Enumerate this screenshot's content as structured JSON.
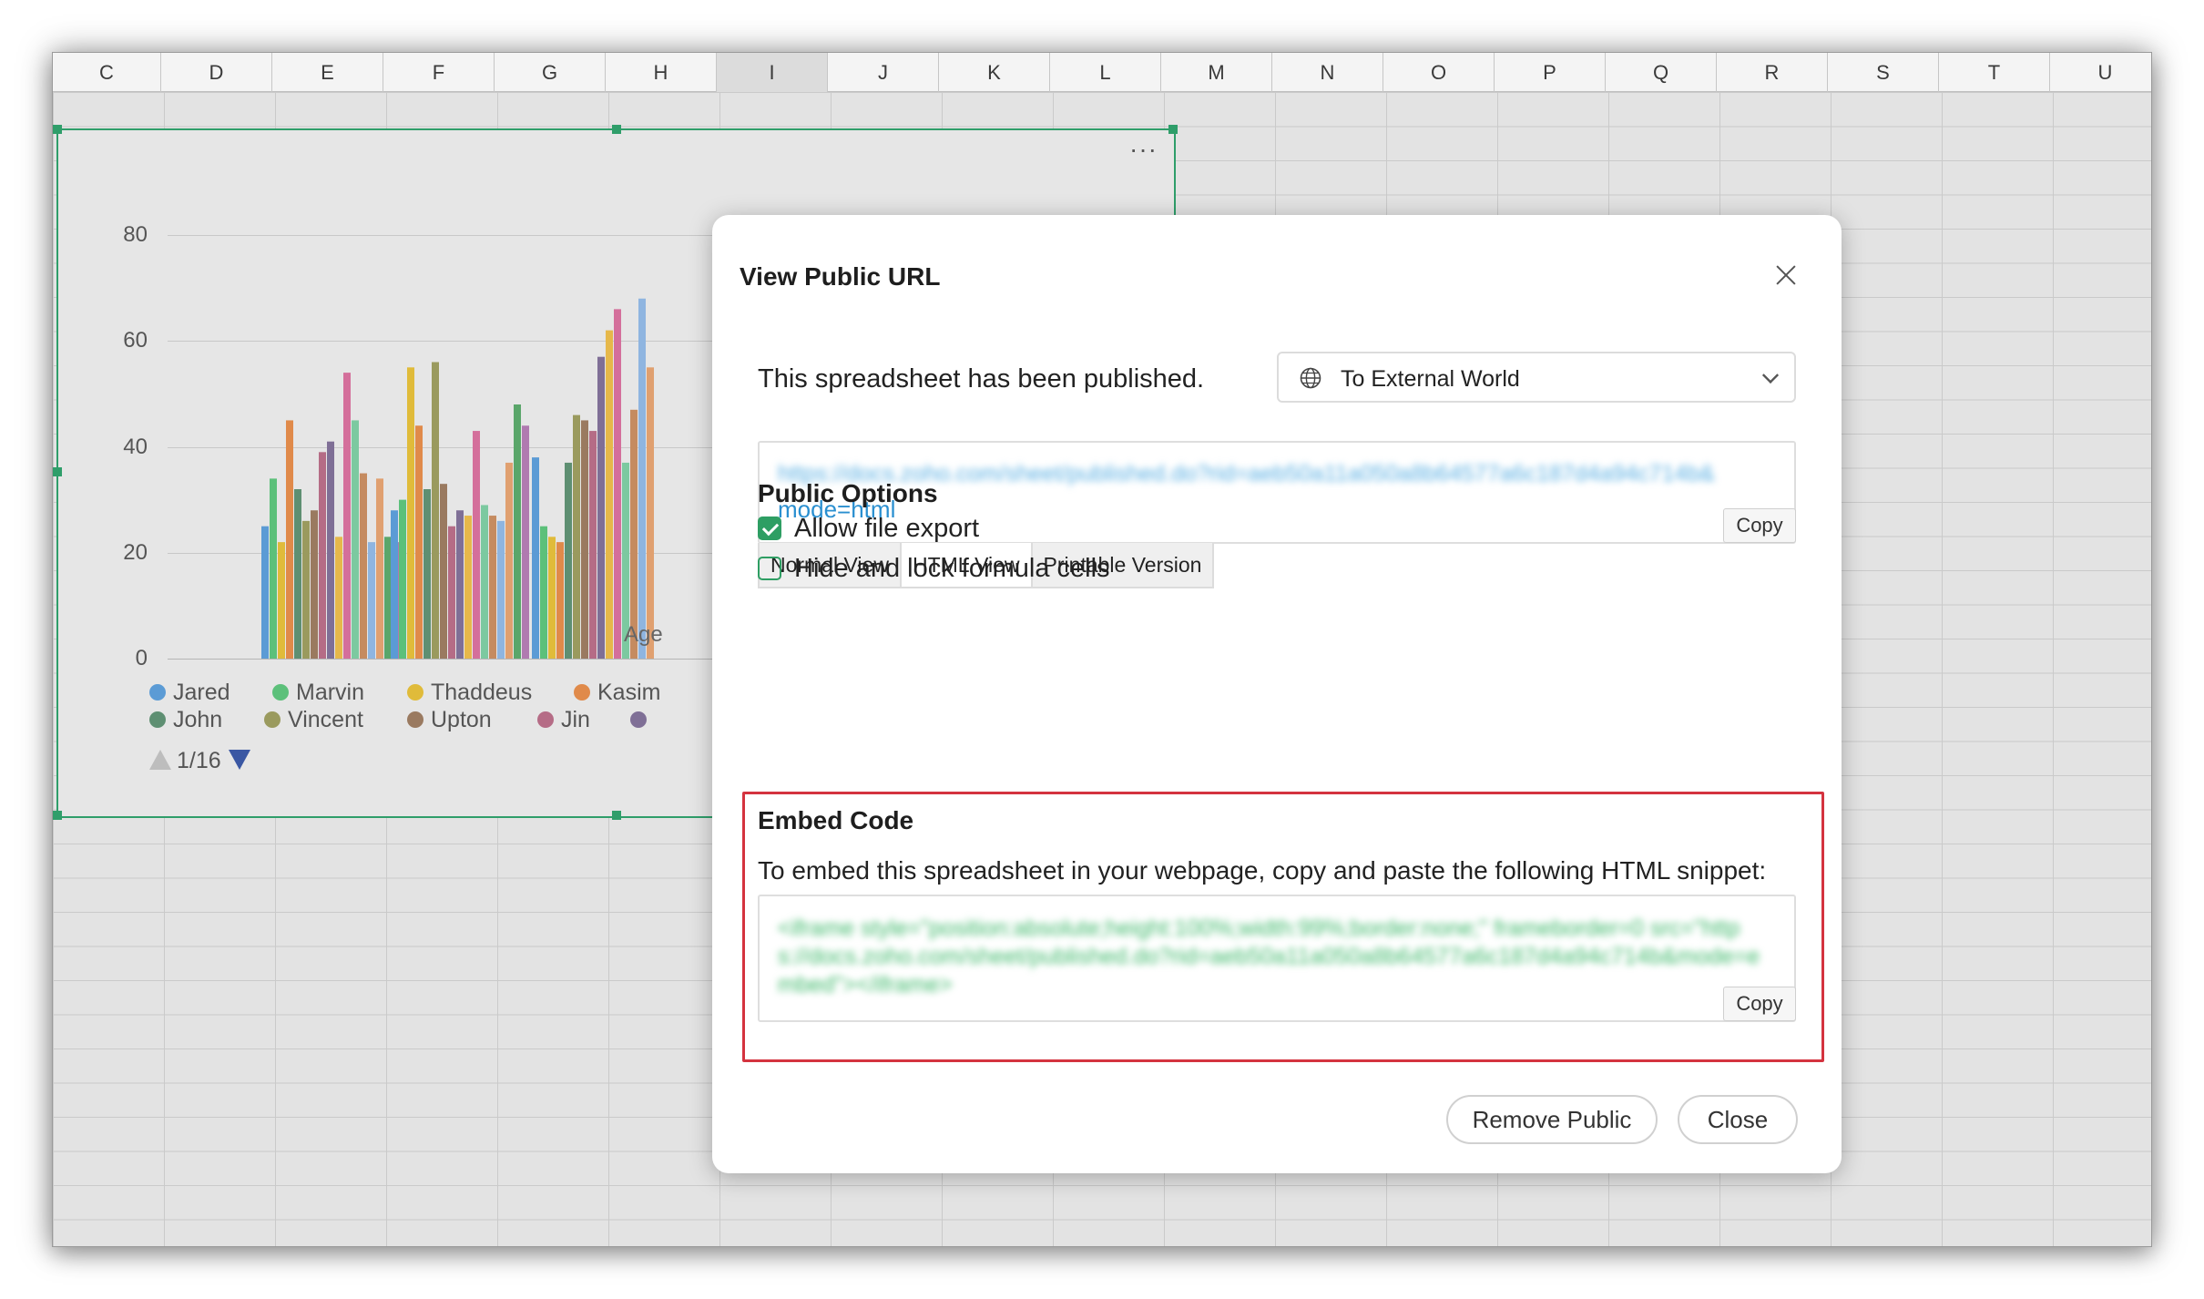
{
  "spreadsheet": {
    "columns": [
      "C",
      "D",
      "E",
      "F",
      "G",
      "H",
      "I",
      "J",
      "K",
      "L",
      "M",
      "N",
      "O",
      "P",
      "Q",
      "R",
      "S",
      "T",
      "U"
    ],
    "selected_column": "I"
  },
  "chart": {
    "menu_icon": "more-horizontal-icon",
    "x_axis_label": "Age",
    "legend": [
      {
        "name": "Jared",
        "color": "#5b9bd5"
      },
      {
        "name": "Marvin",
        "color": "#5cc07a"
      },
      {
        "name": "Thaddeus",
        "color": "#e0bb3a"
      },
      {
        "name": "Kasim",
        "color": "#e08a4a"
      },
      {
        "name": "John",
        "color": "#5e8f72"
      },
      {
        "name": "Vincent",
        "color": "#9a9a5e"
      },
      {
        "name": "Upton",
        "color": "#9a7a60"
      },
      {
        "name": "Jin",
        "color": "#b56c86"
      },
      {
        "name": "",
        "color": "#7f6f96"
      }
    ],
    "pager": "1/16"
  },
  "chart_data": {
    "type": "bar",
    "ylim": [
      0,
      80
    ],
    "y_ticks": [
      "80",
      "60",
      "40",
      "20",
      "0"
    ],
    "xlabel": "Age",
    "groups": [
      [
        25,
        34,
        22,
        45,
        32,
        26,
        28,
        39,
        41,
        23,
        54,
        45,
        35,
        22,
        34,
        23,
        22
      ],
      [
        28,
        30,
        55,
        44,
        32,
        56,
        33,
        25,
        28,
        27,
        43,
        29,
        27,
        26,
        37,
        48,
        44
      ],
      [
        38,
        25,
        23,
        22,
        37,
        46,
        45,
        43,
        57,
        62,
        66,
        37,
        47,
        68,
        55
      ]
    ],
    "colors": [
      "#5b9bd5",
      "#5cc07a",
      "#e0bb3a",
      "#e08a4a",
      "#5e8f72",
      "#9a9a5e",
      "#9a7a60",
      "#b56c86",
      "#7f6f96",
      "#e6b84a",
      "#d46f9b",
      "#7cc9a0",
      "#c58b60",
      "#8fb5e0",
      "#e0a070",
      "#5aa66a",
      "#b07ab0"
    ]
  },
  "dialog": {
    "title": "View Public URL",
    "close_icon": "close-icon",
    "published_text": "This spreadsheet has been published.",
    "visibility_icon": "globe-icon",
    "visibility_value": "To External World",
    "url_blurred": "https://docs.zoho.com/sheet/published.do?rid=aeb50a11a050a8b64577a6c187d4a94c714b&",
    "url_visible": "mode=html",
    "copy_label": "Copy",
    "view_tabs": [
      "Normal View",
      "HTML View",
      "Printable Version"
    ],
    "active_view_tab": "HTML View",
    "public_options_title": "Public Options",
    "allow_export_label": "Allow file export",
    "allow_export_checked": true,
    "hide_formula_label": "Hide and lock formula cells",
    "hide_formula_checked": false,
    "embed_title": "Embed Code",
    "embed_description": "To embed this spreadsheet in your webpage, copy and paste the following HTML snippet:",
    "embed_code_blurred": "<iframe style=\"position:absolute;height:100%;width:99%;border:none;\" frameborder=0 src=\"https://docs.zoho.com/sheet/published.do?rid=aeb50a11a050a8b64577a6c187d4a94c714b&mode=embed\"></iframe>",
    "embed_copy_label": "Copy",
    "remove_public_label": "Remove Public",
    "close_label": "Close"
  }
}
